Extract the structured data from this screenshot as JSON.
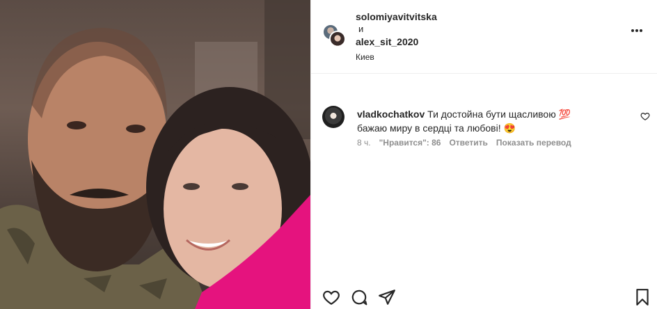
{
  "header": {
    "user1": "solomiyavitvitska",
    "conjunction": "и",
    "user2": "alex_sit_2020",
    "location": "Киев"
  },
  "comment": {
    "username": "vladkochatkov",
    "text_line1": "Ти достойна бути щасливою 💯",
    "text_line2": "бажаю миру в сердці та любові! 😍",
    "time": "8 ч.",
    "likes": "\"Нравится\": 86",
    "reply": "Ответить",
    "translate": "Показать перевод"
  },
  "icons": {
    "more": "more-horizontal-icon",
    "comment_like": "heart-icon",
    "like": "heart-icon",
    "comment": "comment-icon",
    "share": "send-icon",
    "save": "bookmark-icon"
  },
  "colors": {
    "accent_pink": "#e5137e",
    "text": "#262626",
    "muted": "#8e8e8e"
  }
}
